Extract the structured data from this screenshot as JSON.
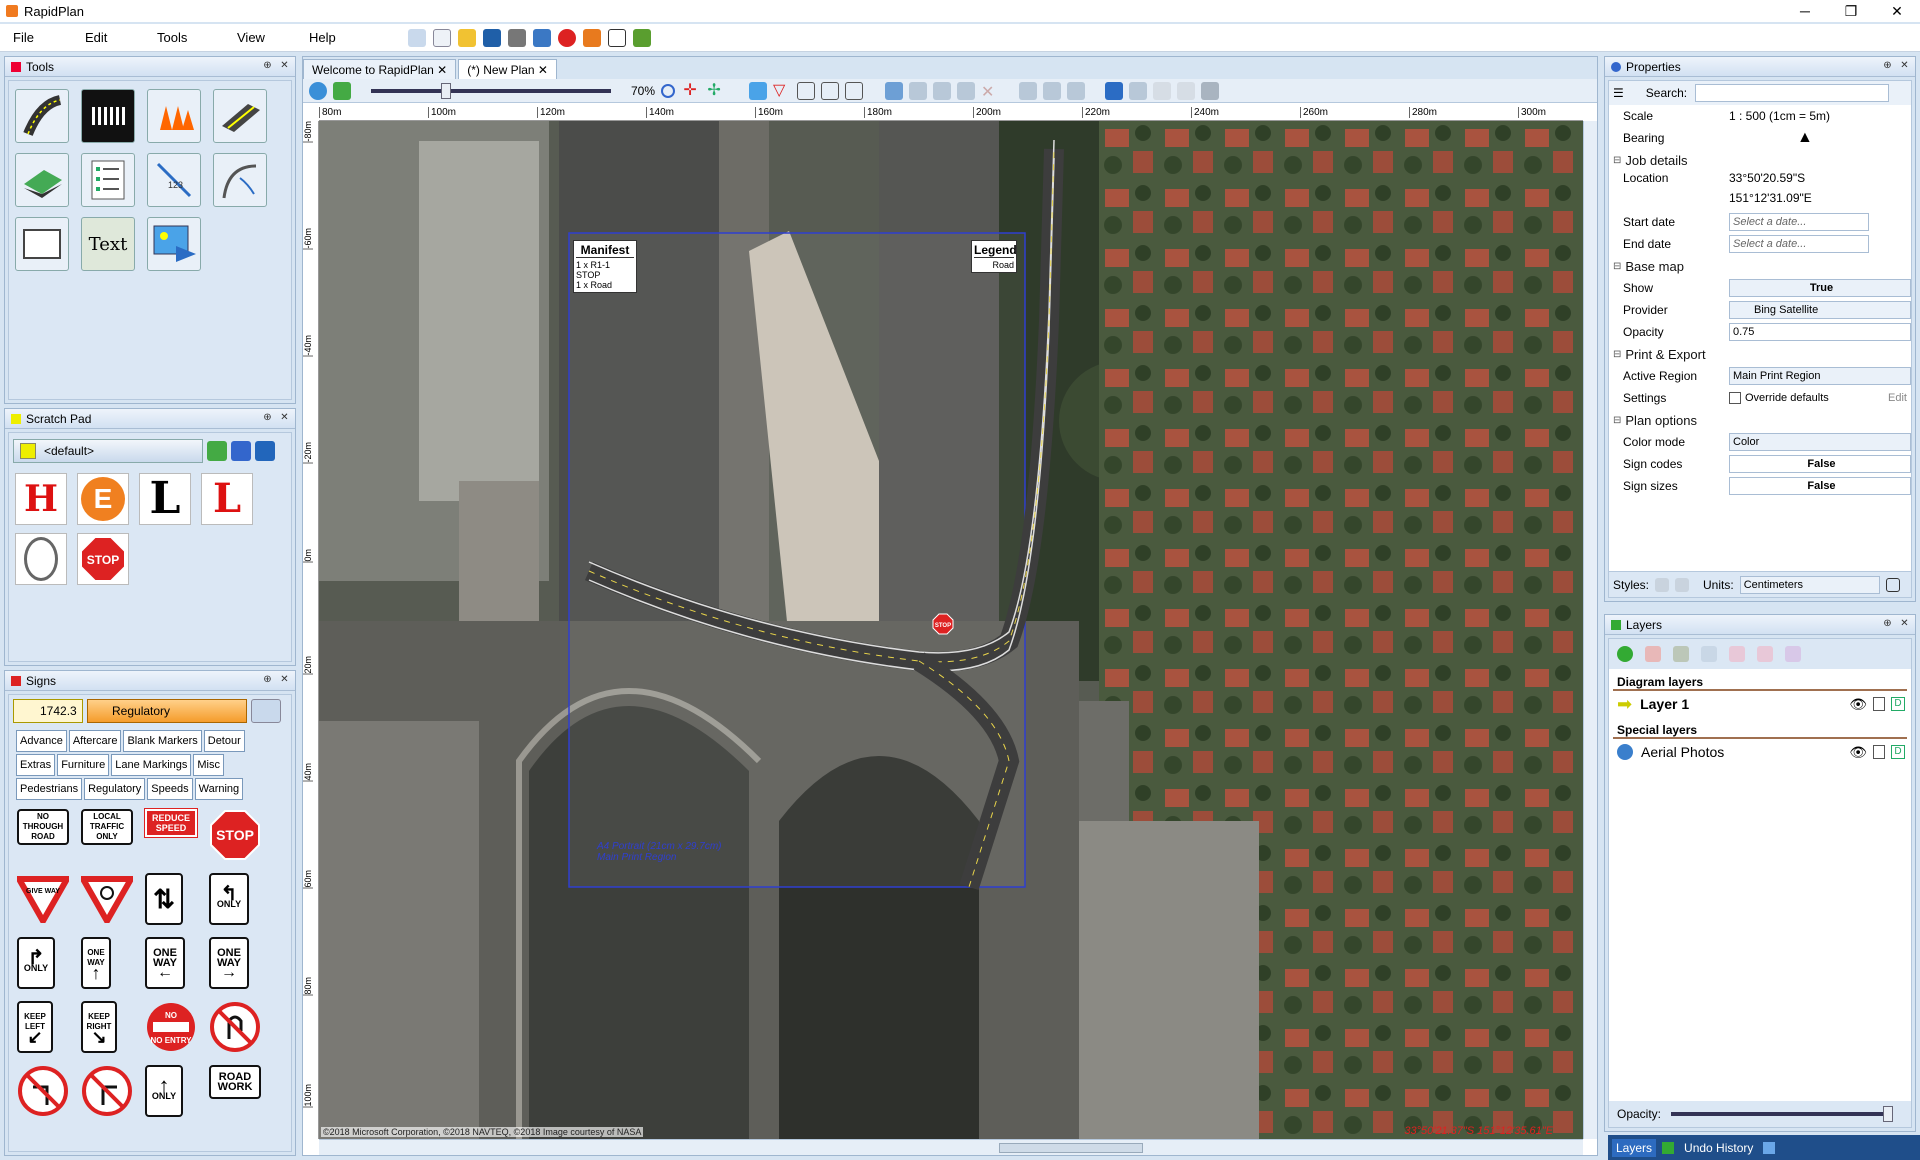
{
  "app": {
    "title": "RapidPlan"
  },
  "menu": [
    "File",
    "Edit",
    "Tools",
    "View",
    "Help"
  ],
  "tools_panel": {
    "title": "Tools",
    "text_tool": "Text"
  },
  "scratch": {
    "title": "Scratch Pad",
    "profile": "<default>",
    "letters": [
      "H",
      "E",
      "L",
      "L"
    ]
  },
  "signs_panel": {
    "title": "Signs",
    "code": "1742.3",
    "category": "Regulatory",
    "categories": [
      "Advance",
      "Aftercare",
      "Blank Markers",
      "Detour",
      "Extras",
      "Furniture",
      "Lane Markings",
      "Misc",
      "Pedestrians",
      "Regulatory",
      "Speeds",
      "Warning"
    ],
    "signs": [
      "NO THROUGH ROAD",
      "LOCAL TRAFFIC ONLY",
      "REDUCE SPEED",
      "STOP",
      "GIVE WAY",
      "",
      "",
      "ONLY",
      "ONLY",
      "ONE WAY",
      "ONE WAY",
      "ONE WAY",
      "KEEP LEFT",
      "KEEP RIGHT",
      "NO ENTRY",
      "",
      "",
      "",
      "ONLY",
      "ROAD WORK"
    ]
  },
  "tabs": [
    {
      "label": "Welcome to RapidPlan"
    },
    {
      "label": "(*) New Plan"
    }
  ],
  "canvas_toolbar": {
    "zoom": "70%"
  },
  "ruler_h": [
    "80m",
    "100m",
    "120m",
    "140m",
    "160m",
    "180m",
    "200m",
    "220m",
    "240m",
    "260m",
    "280m",
    "300m"
  ],
  "ruler_v": [
    "-80m",
    "-60m",
    "-40m",
    "-20m",
    "0m",
    "20m",
    "40m",
    "60m",
    "80m",
    "100m"
  ],
  "manifest": {
    "title": "Manifest",
    "rows": [
      "1 x  R1-1 STOP",
      "1 x  Road"
    ]
  },
  "legend": {
    "title": "Legend",
    "rows": [
      "Road"
    ]
  },
  "print_region": {
    "paper": "A4 Portrait (21cm x 29.7cm)",
    "name": "Main Print Region"
  },
  "stop_text": "STOP",
  "copyright": "©2018 Microsoft Corporation, ©2018 NAVTEQ, ©2018 Image courtesy of NASA",
  "coords_status": "33°50'21.37\"S 151°12'35.61\"E",
  "properties": {
    "title": "Properties",
    "search_label": "Search:",
    "scale_label": "Scale",
    "scale_value": "1 : 500  (1cm = 5m)",
    "bearing_label": "Bearing",
    "job_section": "Job details",
    "location_label": "Location",
    "location_lat": "33°50'20.59\"S",
    "location_lon": "151°12'31.09\"E",
    "start_label": "Start date",
    "end_label": "End date",
    "date_placeholder": "Select a date...",
    "basemap_section": "Base map",
    "show_label": "Show",
    "show_value": "True",
    "provider_label": "Provider",
    "provider_value": "Bing Satellite",
    "opacity_label": "Opacity",
    "opacity_value": "0.75",
    "print_section": "Print & Export",
    "active_label": "Active Region",
    "active_value": "Main Print Region",
    "settings_label": "Settings",
    "override_label": "Override defaults",
    "edit_label": "Edit",
    "plan_section": "Plan options",
    "color_label": "Color mode",
    "color_value": "Color",
    "codes_label": "Sign codes",
    "codes_value": "False",
    "sizes_label": "Sign sizes",
    "sizes_value": "False",
    "styles_label": "Styles:",
    "units_label": "Units:",
    "units_value": "Centimeters"
  },
  "layers": {
    "title": "Layers",
    "diagram_label": "Diagram layers",
    "layer1": "Layer 1",
    "special_label": "Special layers",
    "aerial": "Aerial Photos",
    "opacity_label": "Opacity:"
  },
  "status_tabs": [
    "Layers",
    "Undo History"
  ]
}
